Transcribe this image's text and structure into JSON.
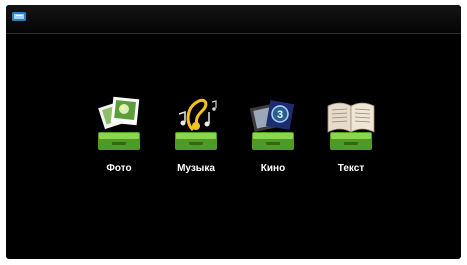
{
  "topbar": {
    "icon": "input-source-icon"
  },
  "menu": {
    "items": [
      {
        "label": "Фото",
        "icon": "photo-stack-icon"
      },
      {
        "label": "Музыка",
        "icon": "music-note-icon"
      },
      {
        "label": "Кино",
        "icon": "film-reel-icon"
      },
      {
        "label": "Текст",
        "icon": "open-book-icon"
      }
    ]
  },
  "colors": {
    "background": "#000000",
    "drawer": "#6dbf3a",
    "label": "#ffffff"
  }
}
